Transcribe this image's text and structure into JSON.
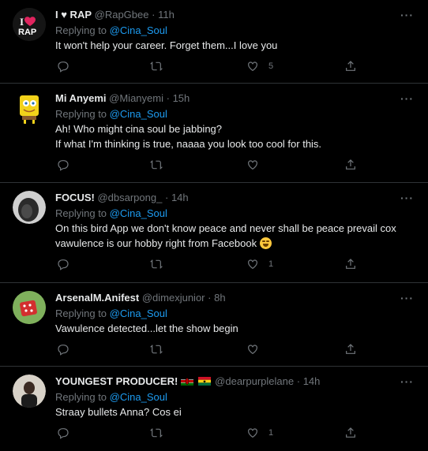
{
  "tweets": [
    {
      "name": "I ♥ RAP",
      "handle": "@RapGbee",
      "time": "11h",
      "replying_prefix": "Replying to",
      "replying_to": "@Cina_Soul",
      "text_lines": [
        "It won't help your career. Forget them...I love you"
      ],
      "likes": "5",
      "retweets": "",
      "replies": ""
    },
    {
      "name": "Mi Anyemi",
      "handle": "@Mianyemi",
      "time": "15h",
      "replying_prefix": "Replying to",
      "replying_to": "@Cina_Soul",
      "text_lines": [
        "Ah! Who might cina soul be jabbing?",
        "If what I'm thinking is true, naaaa you look too cool for this."
      ],
      "likes": "",
      "retweets": "",
      "replies": ""
    },
    {
      "name": "FOCUS!",
      "handle": "@dbsarpong_",
      "time": "14h",
      "replying_prefix": "Replying to",
      "replying_to": "@Cina_Soul",
      "text_lines": [
        "On this bird App we don't know peace and never shall be peace prevail cox",
        "vawulence is our hobby right from Facebook"
      ],
      "emoji": "laughing-emoji",
      "likes": "1",
      "retweets": "",
      "replies": ""
    },
    {
      "name": "ArsenalM.Anifest",
      "handle": "@dimexjunior",
      "time": "8h",
      "replying_prefix": "Replying to",
      "replying_to": "@Cina_Soul",
      "text_lines": [
        "Vawulence detected...let the show begin"
      ],
      "likes": "",
      "retweets": "",
      "replies": ""
    },
    {
      "name": "YOUNGEST PRODUCER!",
      "handle": "@dearpurplelane",
      "time": "14h",
      "flags": [
        "kenya-flag",
        "ghana-flag"
      ],
      "replying_prefix": "Replying to",
      "replying_to": "@Cina_Soul",
      "text_lines": [
        "Straay bullets Anna? Cos ei"
      ],
      "likes": "1",
      "retweets": "",
      "replies": ""
    }
  ],
  "colors": {
    "background": "#000000",
    "text": "#e7e9ea",
    "muted": "#71767b",
    "link": "#1d9bf0",
    "divider": "#2f3336"
  }
}
